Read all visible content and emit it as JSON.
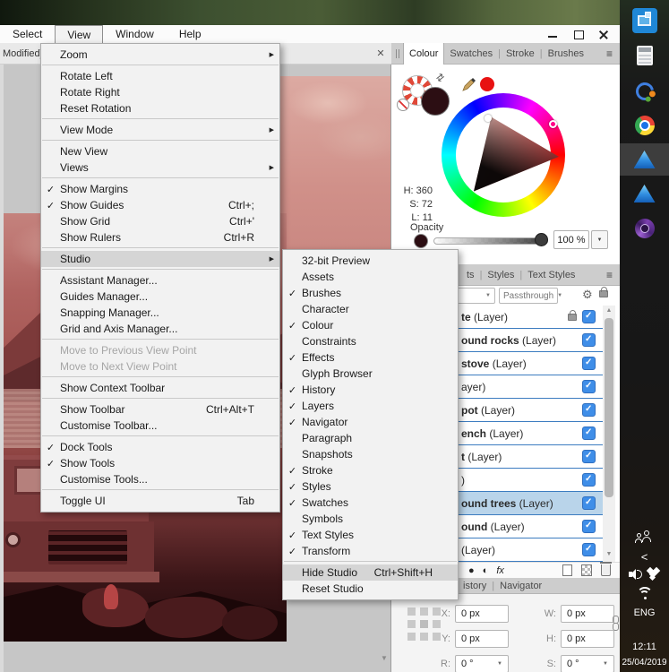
{
  "menubar": {
    "items": [
      {
        "label": "Select"
      },
      {
        "label": "View",
        "active": true
      },
      {
        "label": "Window"
      },
      {
        "label": "Help"
      }
    ]
  },
  "document_tab": {
    "title": "Modified] (",
    "close": "✕"
  },
  "view_menu": {
    "items": [
      {
        "label": "Zoom",
        "submenu": true
      },
      {
        "sep": true
      },
      {
        "label": "Rotate Left"
      },
      {
        "label": "Rotate Right"
      },
      {
        "label": "Reset Rotation"
      },
      {
        "sep": true
      },
      {
        "label": "View Mode",
        "submenu": true
      },
      {
        "sep": true
      },
      {
        "label": "New View"
      },
      {
        "label": "Views",
        "submenu": true
      },
      {
        "sep": true
      },
      {
        "label": "Show Margins",
        "checked": true
      },
      {
        "label": "Show Guides",
        "checked": true,
        "shortcut": "Ctrl+;"
      },
      {
        "label": "Show Grid",
        "shortcut": "Ctrl+'"
      },
      {
        "label": "Show Rulers",
        "shortcut": "Ctrl+R"
      },
      {
        "sep": true
      },
      {
        "label": "Studio",
        "submenu": true,
        "highlighted": true
      },
      {
        "sep": true
      },
      {
        "label": "Assistant Manager..."
      },
      {
        "label": "Guides Manager..."
      },
      {
        "label": "Snapping Manager..."
      },
      {
        "label": "Grid and Axis Manager..."
      },
      {
        "sep": true
      },
      {
        "label": "Move to Previous View Point",
        "disabled": true
      },
      {
        "label": "Move to Next View Point",
        "disabled": true
      },
      {
        "sep": true
      },
      {
        "label": "Show Context Toolbar"
      },
      {
        "sep": true
      },
      {
        "label": "Show Toolbar",
        "shortcut": "Ctrl+Alt+T"
      },
      {
        "label": "Customise Toolbar..."
      },
      {
        "sep": true
      },
      {
        "label": "Dock Tools",
        "checked": true
      },
      {
        "label": "Show Tools",
        "checked": true
      },
      {
        "label": "Customise Tools..."
      },
      {
        "sep": true
      },
      {
        "label": "Toggle UI",
        "shortcut": "Tab"
      }
    ]
  },
  "studio_submenu": {
    "items": [
      {
        "label": "32-bit Preview"
      },
      {
        "label": "Assets"
      },
      {
        "label": "Brushes",
        "checked": true
      },
      {
        "label": "Character"
      },
      {
        "label": "Colour",
        "checked": true
      },
      {
        "label": "Constraints"
      },
      {
        "label": "Effects",
        "checked": true
      },
      {
        "label": "Glyph Browser"
      },
      {
        "label": "History",
        "checked": true
      },
      {
        "label": "Layers",
        "checked": true
      },
      {
        "label": "Navigator",
        "checked": true
      },
      {
        "label": "Paragraph"
      },
      {
        "label": "Snapshots"
      },
      {
        "label": "Stroke",
        "checked": true
      },
      {
        "label": "Styles",
        "checked": true
      },
      {
        "label": "Swatches",
        "checked": true
      },
      {
        "label": "Symbols"
      },
      {
        "label": "Text Styles",
        "checked": true
      },
      {
        "label": "Transform",
        "checked": true
      },
      {
        "sep": true
      },
      {
        "label": "Hide Studio",
        "shortcut": "Ctrl+Shift+H",
        "highlighted": true
      },
      {
        "label": "Reset Studio"
      }
    ]
  },
  "colour_panel": {
    "tabs": [
      {
        "label": "Colour",
        "active": true
      },
      {
        "label": "Swatches"
      },
      {
        "label": "Stroke"
      },
      {
        "label": "Brushes"
      }
    ],
    "readouts": [
      {
        "label": "H: 360"
      },
      {
        "label": "S: 72"
      },
      {
        "label": "L: 11"
      }
    ],
    "opacity_label": "Opacity",
    "opacity_value": "100 %"
  },
  "layers_panel": {
    "tabs": [
      {
        "label": "ts"
      },
      {
        "label": "Styles"
      },
      {
        "label": "Text Styles"
      }
    ],
    "blend_mode": "Passthrough",
    "fx_label": "fx",
    "layers": [
      {
        "bold": "te",
        "rest": " (Layer)",
        "locked": true,
        "checked": true
      },
      {
        "bold": "ound rocks",
        "rest": " (Layer)",
        "checked": true
      },
      {
        "bold": "stove",
        "rest": " (Layer)",
        "checked": true
      },
      {
        "bold": "",
        "rest": "ayer)",
        "checked": true
      },
      {
        "bold": "pot",
        "rest": " (Layer)",
        "checked": true
      },
      {
        "bold": "ench",
        "rest": " (Layer)",
        "checked": true
      },
      {
        "bold": "t",
        "rest": " (Layer)",
        "checked": true
      },
      {
        "bold": "",
        "rest": ")",
        "checked": true
      },
      {
        "bold": "ound trees",
        "rest": " (Layer)",
        "checked": true,
        "selected": true
      },
      {
        "bold": "ound",
        "rest": " (Layer)",
        "checked": true
      },
      {
        "bold": "",
        "rest": "(Layer)",
        "checked": true
      }
    ]
  },
  "bottom_tabs": {
    "tabs": [
      {
        "label": "istory"
      },
      {
        "label": "Navigator"
      }
    ]
  },
  "transform_panel": {
    "fields": [
      {
        "label": "X:",
        "value": "0 px"
      },
      {
        "label": "W:",
        "value": "0 px"
      },
      {
        "label": "Y:",
        "value": "0 px"
      },
      {
        "label": "H:",
        "value": "0 px"
      },
      {
        "label": "R:",
        "value": "0 °",
        "dropdown": true
      },
      {
        "label": "S:",
        "value": "0 °",
        "dropdown": true
      }
    ]
  },
  "taskbar": {
    "lang": "ENG",
    "time": "12:11",
    "date": "25/04/2019"
  }
}
